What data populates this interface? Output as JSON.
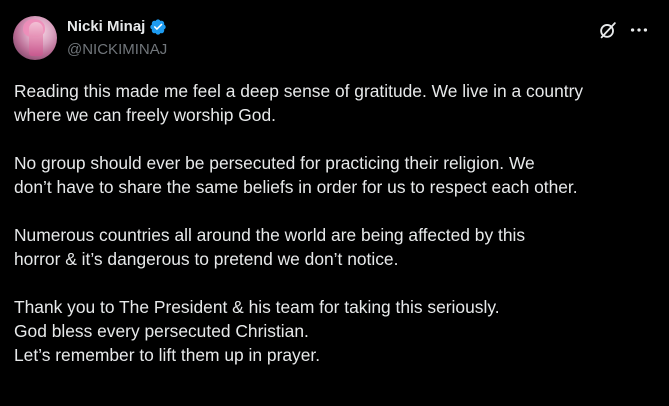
{
  "author": {
    "display_name": "Nicki Minaj",
    "handle": "@NICKIMINAJ",
    "verified": true
  },
  "icons": {
    "avatar": "profile-photo",
    "verified": "verified-badge-icon",
    "grok": "grok-icon",
    "more": "more-options-icon"
  },
  "colors": {
    "background": "#000000",
    "text": "#e7e9ea",
    "secondary_text": "#71767b",
    "verified_blue": "#1d9bf0"
  },
  "post": {
    "paragraphs": [
      "Reading this made me feel a deep sense of gratitude. We live in a country\nwhere we can freely worship God.",
      "No group should ever be persecuted for practicing their religion. We\ndon’t have to share the same beliefs in order for us to respect each other.",
      "Numerous countries all around the world are being affected by this\nhorror & it’s dangerous to pretend we don’t notice.",
      "Thank you to The President & his team for taking this seriously.\nGod bless every persecuted Christian.\nLet’s remember to lift them up in prayer."
    ]
  }
}
